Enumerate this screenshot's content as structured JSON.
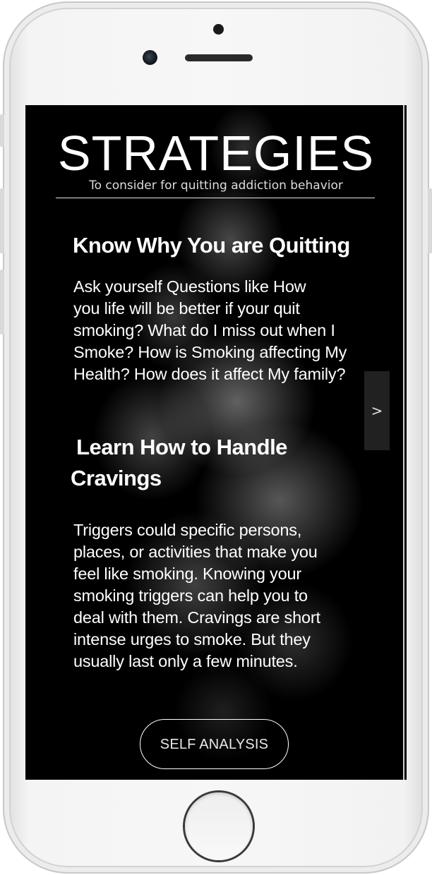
{
  "screen": {
    "title": "STRATEGIES",
    "subtitle": "To consider for quitting addiction behavior"
  },
  "sections": [
    {
      "heading": "Know Why You are Quitting",
      "body_lines": [
        "Ask yourself Questions like How",
        "you life will be better if your quit",
        "smoking? What do I miss out when I",
        "Smoke? How is Smoking affecting My",
        "Health? How does it affect My family?"
      ]
    },
    {
      "heading_lines": [
        " Learn How to Handle",
        "Cravings"
      ],
      "body_lines": [
        "Triggers could specific persons,",
        "places, or activities that make you",
        "feel like smoking. Knowing your",
        "smoking triggers can help you to",
        "deal with them. Cravings are short",
        "intense urges to smoke. But they",
        "usually last only a few minutes."
      ]
    }
  ],
  "navigation": {
    "next_label": ">"
  },
  "cta": {
    "label": "SELF ANALYSIS"
  },
  "colors": {
    "screen_background": "#000000",
    "text": "#ffffff",
    "phone_body": "#f4f4f4"
  }
}
